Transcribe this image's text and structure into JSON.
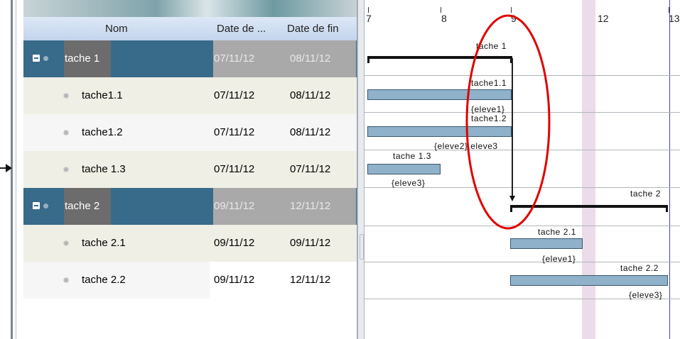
{
  "grid": {
    "columns": [
      "Nom",
      "Date de ...",
      "Date de fin"
    ],
    "rows": [
      {
        "name": "tache 1",
        "start": "07/11/12",
        "end": "08/11/12",
        "type": "parent"
      },
      {
        "name": "tache1.1",
        "start": "07/11/12",
        "end": "08/11/12",
        "type": "child"
      },
      {
        "name": "tache1.2",
        "start": "07/11/12",
        "end": "08/11/12",
        "type": "child"
      },
      {
        "name": "tache 1.3",
        "start": "07/11/12",
        "end": "07/11/12",
        "type": "child"
      },
      {
        "name": "tache 2",
        "start": "09/11/12",
        "end": "12/11/12",
        "type": "parent"
      },
      {
        "name": "tache 2.1",
        "start": "09/11/12",
        "end": "09/11/12",
        "type": "child"
      },
      {
        "name": "tache 2.2",
        "start": "09/11/12",
        "end": "12/11/12",
        "type": "child"
      }
    ]
  },
  "gantt": {
    "ticks": [
      "7",
      "8",
      "9",
      "12",
      "13"
    ],
    "labels": {
      "t1": "tache 1",
      "t11": "tache1.1",
      "t11r": "{eleve1}",
      "t12": "tache1.2",
      "t12r": "{eleve2},eleve3",
      "t13": "tache 1.3",
      "t13r": "{eleve3}",
      "t2": "tache 2",
      "t21": "tache 2.1",
      "t21r": "{eleve1}",
      "t22": "tache 2.2",
      "t22r": "{eleve3}"
    }
  },
  "colors": {
    "parent_row": "#386a8a",
    "bar": "#8fb1ca",
    "highlight": "#e00000"
  }
}
